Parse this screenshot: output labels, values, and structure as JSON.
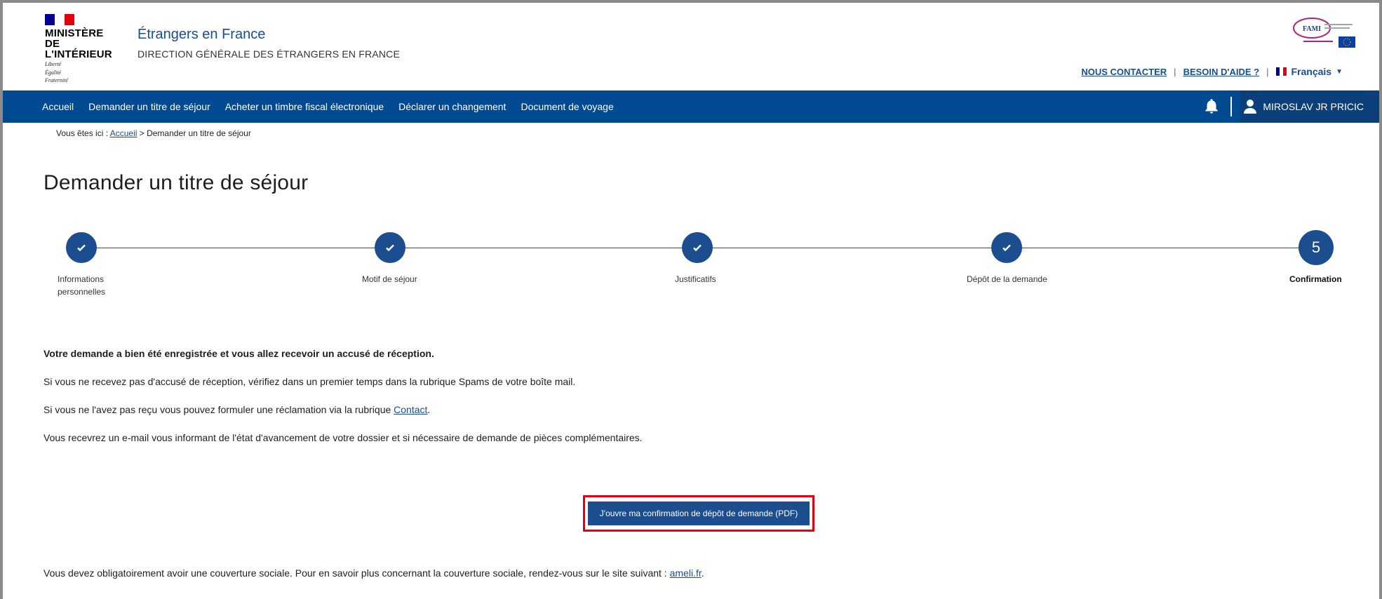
{
  "header": {
    "ministry_line1": "Ministère",
    "ministry_line2": "de l'Intérieur",
    "motto_1": "Liberté",
    "motto_2": "Égalité",
    "motto_3": "Fraternité",
    "site_title": "Étrangers en France",
    "site_subtitle": "Direction générale des étrangers en France",
    "fami_text": "FAMI",
    "links": {
      "contact": "NOUS CONTACTER",
      "help": "BESOIN D'AIDE ?",
      "language": "Français"
    }
  },
  "nav": {
    "items": [
      "Accueil",
      "Demander un titre de séjour",
      "Acheter un timbre fiscal électronique",
      "Déclarer un changement",
      "Document de voyage"
    ],
    "user": "MIROSLAV JR PRICIC"
  },
  "breadcrumb": {
    "prefix": "Vous êtes ici :",
    "home": "Accueil",
    "current": "> Demander un titre de séjour"
  },
  "page_title": "Demander un titre de séjour",
  "stepper": {
    "steps": [
      {
        "label_1": "Informations",
        "label_2": "personnelles"
      },
      {
        "label_1": "Motif de séjour"
      },
      {
        "label_1": "Justificatifs"
      },
      {
        "label_1": "Dépôt de la demande"
      },
      {
        "label_1": "Confirmation",
        "number": "5"
      }
    ]
  },
  "content": {
    "confirmation": "Votre demande a bien été enregistrée et vous allez recevoir un accusé de réception.",
    "spam_note": "Si vous ne recevez pas d'accusé de réception, vérifiez dans un premier temps dans la rubrique Spams de votre boîte mail.",
    "claim_prefix": "Si vous ne l'avez pas reçu vous pouvez formuler une réclamation via la rubrique",
    "claim_link": "Contact",
    "claim_suffix": ".",
    "email_note": "Vous recevrez un e-mail vous informant de l'état d'avancement de votre dossier et si nécessaire de demande de pièces complémentaires.",
    "cta": "J'ouvre ma confirmation de dépôt de demande (PDF)",
    "social_prefix": "Vous devez obligatoirement avoir une couverture sociale. Pour en savoir plus concernant la couverture sociale, rendez-vous sur le site suivant :",
    "social_link": "ameli.fr",
    "social_suffix": "."
  },
  "colors": {
    "primary": "#1b4d8f",
    "nav_bg": "#004a91",
    "highlight": "#e3000f"
  }
}
